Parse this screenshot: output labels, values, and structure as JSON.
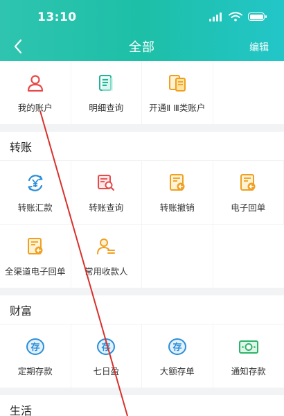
{
  "status_bar": {
    "time": "13:10"
  },
  "nav": {
    "title": "全部",
    "edit_label": "编辑"
  },
  "top_section": {
    "items": [
      {
        "label": "我的账户",
        "icon": "person-icon"
      },
      {
        "label": "明细查询",
        "icon": "document-list-icon"
      },
      {
        "label": "开通Ⅱ Ⅲ类账户",
        "icon": "card-account-icon"
      }
    ]
  },
  "transfer": {
    "title": "转账",
    "items": [
      {
        "label": "转账汇款",
        "icon": "yuan-transfer-icon"
      },
      {
        "label": "转账查询",
        "icon": "search-document-icon"
      },
      {
        "label": "转账撤销",
        "icon": "receipt-revoke-icon"
      },
      {
        "label": "电子回单",
        "icon": "receipt-icon"
      },
      {
        "label": "全渠道电子回单",
        "icon": "receipt-all-channels-icon"
      },
      {
        "label": "常用收款人",
        "icon": "contact-icon"
      }
    ]
  },
  "wealth": {
    "title": "财富",
    "items": [
      {
        "label": "定期存款",
        "icon": "deposit-icon"
      },
      {
        "label": "七日盈",
        "icon": "deposit-icon"
      },
      {
        "label": "大额存单",
        "icon": "deposit-icon"
      },
      {
        "label": "通知存款",
        "icon": "cash-icon"
      }
    ]
  },
  "life": {
    "title": "生活"
  },
  "colors": {
    "header": "#1dbfa7",
    "red_icon": "#e84a4a",
    "teal_icon": "#1fb39a",
    "orange_icon": "#f0a020",
    "blue_icon": "#2b8fd8",
    "green_icon": "#2bb36a"
  }
}
